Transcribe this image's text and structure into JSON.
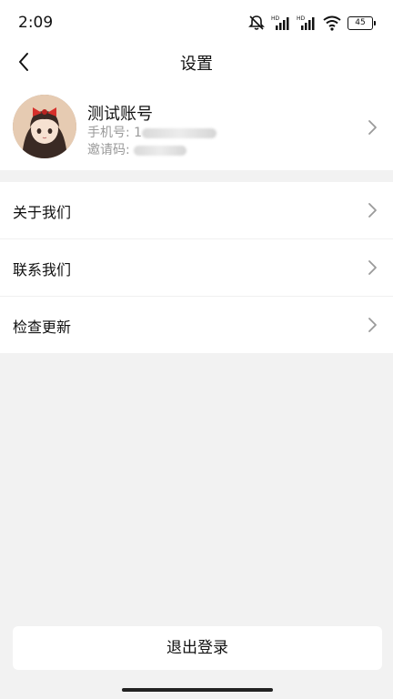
{
  "status_bar": {
    "time": "2:09",
    "battery": "45",
    "icons": [
      "mute-icon",
      "hd-signal-icon",
      "hd-signal-icon",
      "wifi-icon",
      "battery-icon"
    ]
  },
  "header": {
    "title": "设置",
    "back_icon": "chevron-left-icon"
  },
  "profile": {
    "name": "测试账号",
    "phone_label": "手机号: 1",
    "invite_label": "邀请码: ",
    "avatar": "anime-girl-avatar"
  },
  "menu": {
    "items": [
      {
        "label": "关于我们"
      },
      {
        "label": "联系我们"
      },
      {
        "label": "检查更新"
      }
    ]
  },
  "logout_label": "退出登录",
  "colors": {
    "background": "#f2f2f2",
    "card": "#ffffff",
    "secondary_text": "#9a9a9a",
    "chevron": "#9a9a9a"
  }
}
